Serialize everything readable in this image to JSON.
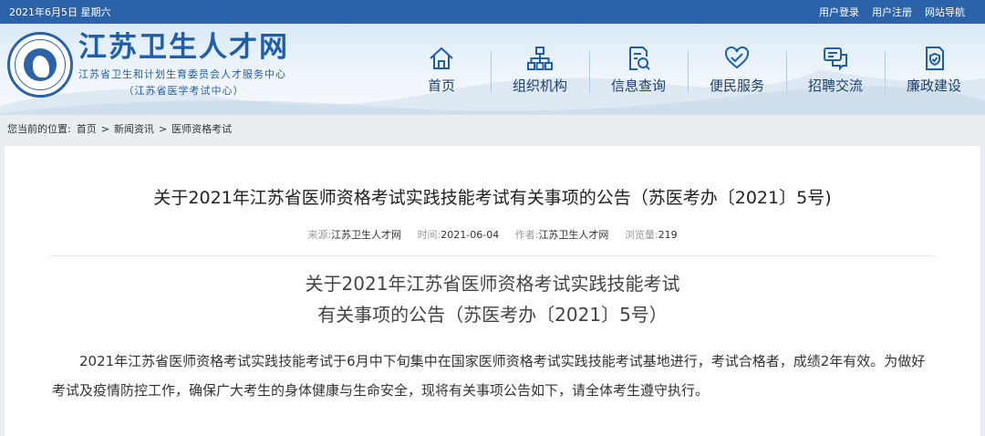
{
  "topbar": {
    "date": "2021年6月5日 星期六",
    "links": [
      "用户登录",
      "用户注册",
      "网站导航"
    ]
  },
  "logo": {
    "title": "江苏卫生人才网",
    "subtitle": "江苏省卫生和计划生育委员会人才服务中心",
    "subtitle2": "（江苏省医学考试中心）"
  },
  "nav": [
    {
      "label": "首页",
      "icon": "home-icon"
    },
    {
      "label": "组织机构",
      "icon": "org-chart-icon"
    },
    {
      "label": "信息查询",
      "icon": "search-document-icon"
    },
    {
      "label": "便民服务",
      "icon": "heart-hand-icon"
    },
    {
      "label": "招聘交流",
      "icon": "chat-icon"
    },
    {
      "label": "廉政建设",
      "icon": "shield-document-icon"
    }
  ],
  "breadcrumb": {
    "prefix": "您当前的位置:",
    "items": [
      "首页",
      "新闻资讯",
      "医师资格考试"
    ],
    "sep": ">"
  },
  "article": {
    "title": "关于2021年江苏省医师资格考试实践技能考试有关事项的公告（苏医考办〔2021〕5号)",
    "meta": {
      "source_label": "来源:",
      "source": "江苏卫生人才网",
      "time_label": "时间:",
      "time": "2021-06-04",
      "author_label": "作者:",
      "author": "江苏卫生人才网",
      "views_label": "浏览量:",
      "views": "219"
    },
    "heading_line1": "关于2021年江苏省医师资格考试实践技能考试",
    "heading_line2": "有关事项的公告（苏医考办〔2021〕5号）",
    "paragraph": "2021年江苏省医师资格考试实践技能考试于6月中下旬集中在国家医师资格考试实践技能考试基地进行，考试合格者，成绩2年有效。为做好考试及疫情防控工作，确保广大考生的身体健康与生命安全，现将有关事项公告如下，请全体考生遵守执行。"
  },
  "colors": {
    "brand": "#2b62a8",
    "nav_text": "#1c3f6e"
  }
}
